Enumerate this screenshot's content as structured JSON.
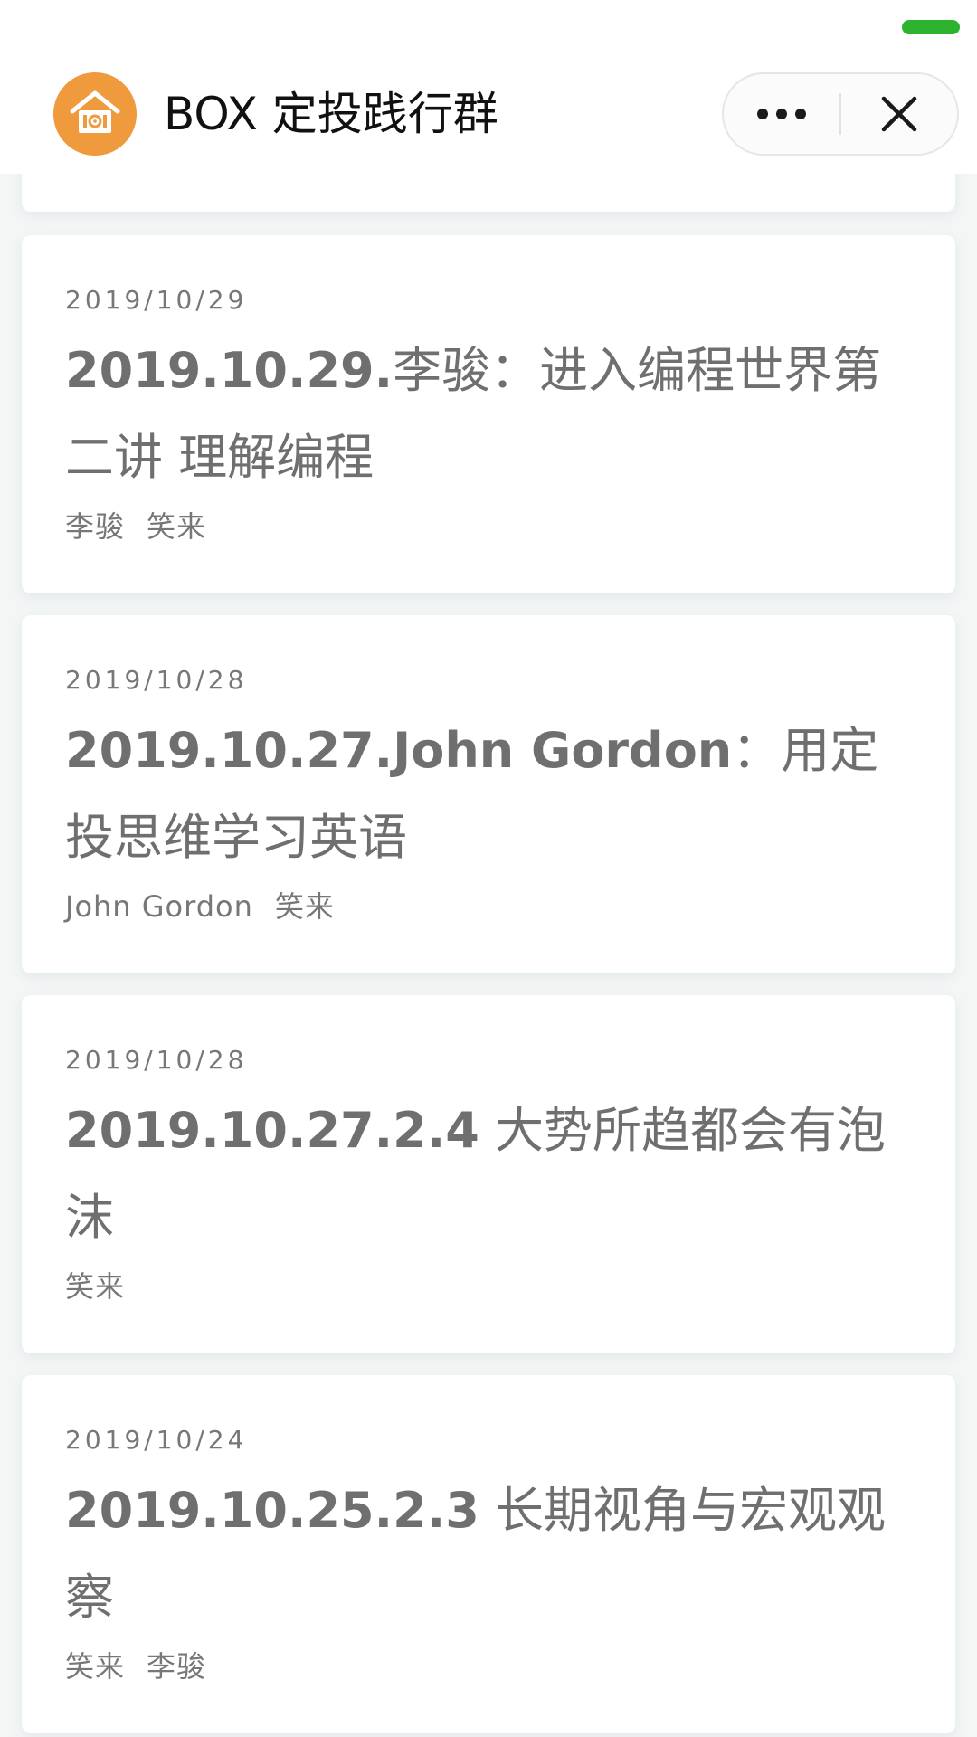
{
  "nav": {
    "title": "BOX 定投践行群",
    "logo_icon": "home-coin-icon",
    "more_icon": "more-dots-icon",
    "close_icon": "close-icon",
    "indicator_color": "#2db32d",
    "logo_color": "#ef9a3c"
  },
  "articles": [
    {
      "date": "2019/10/29",
      "title_num": "2019.10.29.",
      "title_rest": "李骏：进入编程世界第二讲 理解编程",
      "authors": [
        "李骏",
        "笑来"
      ]
    },
    {
      "date": "2019/10/28",
      "title_num": "2019.10.27.John Gordon",
      "title_rest": "：用定投思维学习英语",
      "authors": [
        "John Gordon",
        "笑来"
      ]
    },
    {
      "date": "2019/10/28",
      "title_num": "2019.10.27.2.4",
      "title_rest": " 大势所趋都会有泡沫",
      "authors": [
        "笑来"
      ]
    },
    {
      "date": "2019/10/24",
      "title_num": "2019.10.25.2.3",
      "title_rest": " 长期视角与宏观观察",
      "authors": [
        "笑来",
        "李骏"
      ]
    }
  ]
}
